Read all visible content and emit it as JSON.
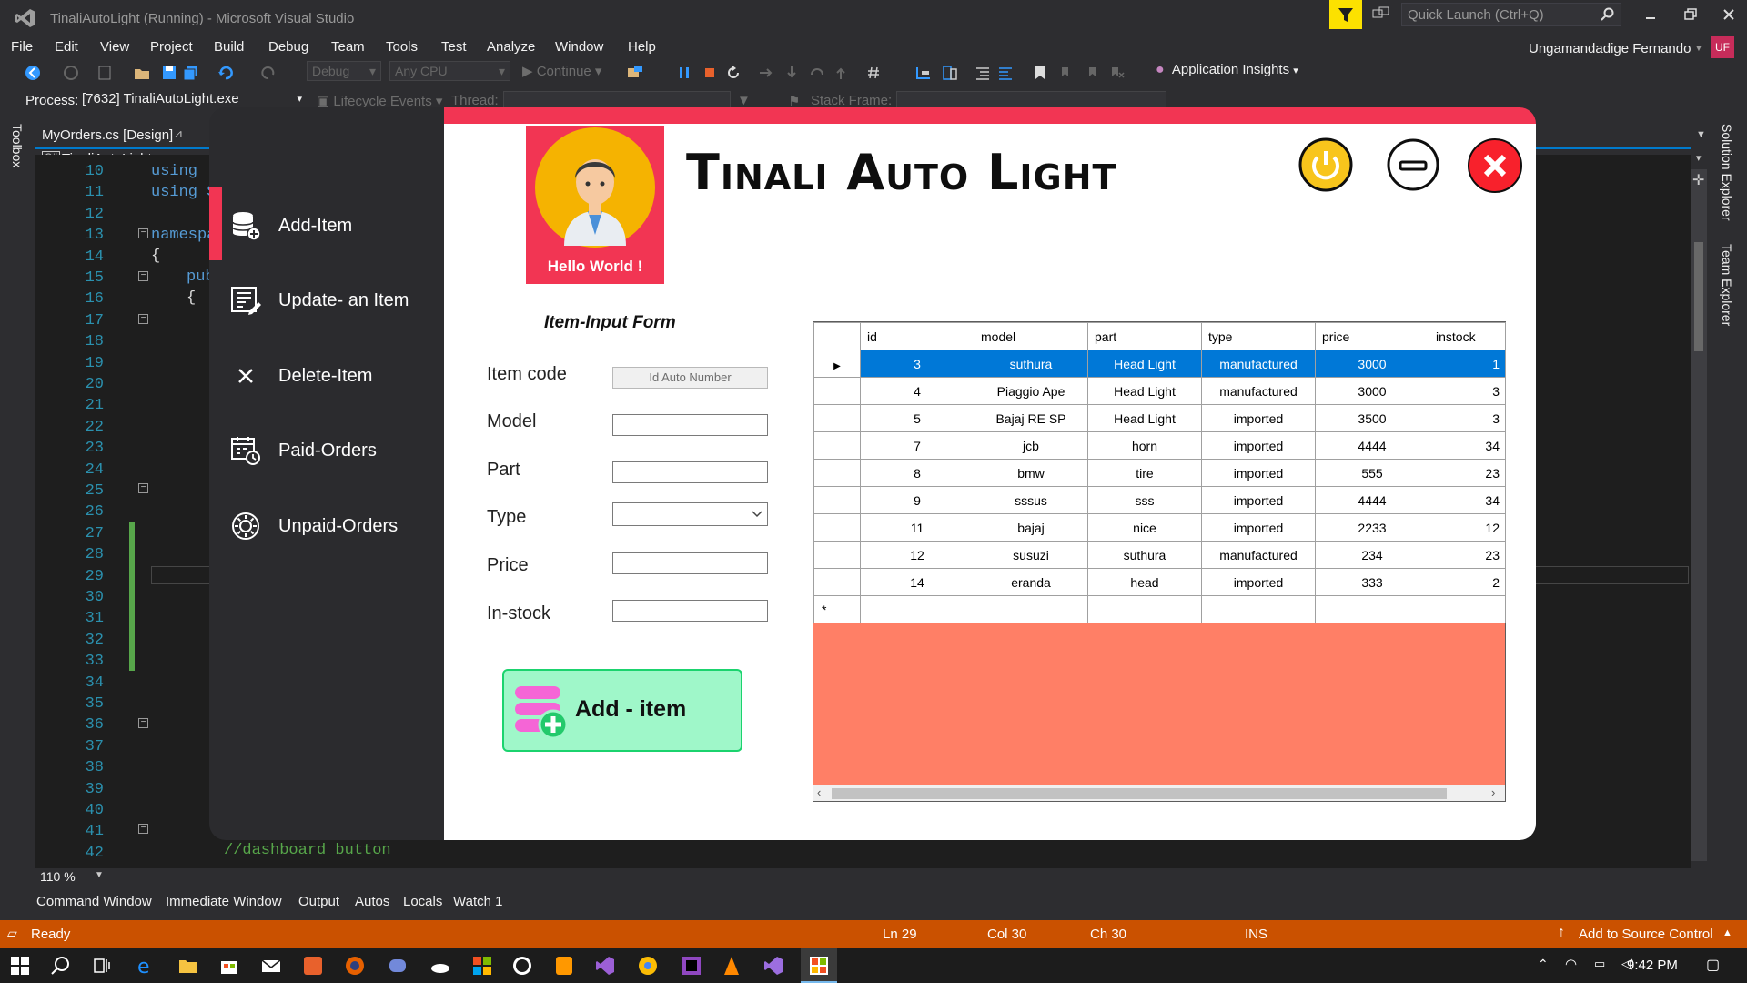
{
  "vs": {
    "title": "TinaliAutoLight (Running) - Microsoft Visual Studio",
    "quick_launch_placeholder": "Quick Launch (Ctrl+Q)",
    "user_name": "Ungamandadige Fernando",
    "user_initials": "UF",
    "menu": [
      "File",
      "Edit",
      "View",
      "Project",
      "Build",
      "Debug",
      "Team",
      "Tools",
      "Test",
      "Analyze",
      "Window",
      "Help"
    ],
    "toolbar": {
      "config": "Debug",
      "platform": "Any CPU",
      "continue_label": "Continue",
      "app_insights": "Application Insights"
    },
    "debugbar": {
      "process_label": "Process:",
      "process_value": "[7632] TinaliAutoLight.exe",
      "lifecycle_label": "Lifecycle Events",
      "thread_label": "Thread:",
      "stack_label": "Stack Frame:"
    },
    "toolbox_label": "Toolbox",
    "doc_tab": "MyOrders.cs [Design]",
    "breadcrumb": "TinaliAutoLight",
    "right_strip": [
      "Solution Explorer",
      "Team Explorer"
    ],
    "line_numbers": [
      "10",
      "11",
      "12",
      "13",
      "14",
      "15",
      "16",
      "17",
      "18",
      "19",
      "20",
      "21",
      "22",
      "23",
      "24",
      "25",
      "26",
      "27",
      "28",
      "29",
      "30",
      "31",
      "32",
      "33",
      "34",
      "35",
      "36",
      "37",
      "38",
      "39",
      "40",
      "41",
      "42"
    ],
    "code": {
      "l10": "using",
      "l11": "using S",
      "l13": "namespa",
      "l14": "{",
      "l15": "pub",
      "l16": "{",
      "comment": "//dashboard button"
    },
    "zoom": "110 %",
    "bottom_tabs": [
      "Command Window",
      "Immediate Window",
      "Output",
      "Autos",
      "Locals",
      "Watch 1"
    ],
    "status": {
      "ready": "Ready",
      "ln": "Ln 29",
      "col": "Col 30",
      "ch": "Ch 30",
      "ins": "INS",
      "source_control": "Add to Source Control"
    },
    "clock": "9:42 PM"
  },
  "app": {
    "brand_title": "Tinali Auto Light",
    "avatar_caption": "Hello World !",
    "nav": [
      {
        "label": "Add-Item",
        "icon": "database-add-icon"
      },
      {
        "label": "Update- an Item",
        "icon": "edit-list-icon"
      },
      {
        "label": "Delete-Item",
        "icon": "close-icon"
      },
      {
        "label": "Paid-Orders",
        "icon": "calendar-clock-icon"
      },
      {
        "label": "Unpaid-Orders",
        "icon": "circle-gear-icon"
      }
    ],
    "form": {
      "title": "Item-Input Form",
      "item_code_label": "Item code",
      "item_code_value": "Id Auto Number",
      "model_label": "Model",
      "part_label": "Part",
      "type_label": "Type",
      "price_label": "Price",
      "instock_label": "In-stock",
      "add_button": "Add - item"
    },
    "grid": {
      "columns": [
        "id",
        "model",
        "part",
        "type",
        "price",
        "instock"
      ],
      "rows": [
        [
          "3",
          "suthura",
          "Head Light",
          "manufactured",
          "3000",
          "1"
        ],
        [
          "4",
          "Piaggio Ape",
          "Head Light",
          "manufactured",
          "3000",
          "3"
        ],
        [
          "5",
          "Bajaj RE SP",
          "Head Light",
          "imported",
          "3500",
          "3"
        ],
        [
          "7",
          "jcb",
          "horn",
          "imported",
          "4444",
          "34"
        ],
        [
          "8",
          "bmw",
          "tire",
          "imported",
          "555",
          "23"
        ],
        [
          "9",
          "sssus",
          "sss",
          "imported",
          "4444",
          "34"
        ],
        [
          "11",
          "bajaj",
          "nice",
          "imported",
          "2233",
          "12"
        ],
        [
          "12",
          "susuzi",
          "suthura",
          "manufactured",
          "234",
          "23"
        ],
        [
          "14",
          "eranda",
          "head",
          "imported",
          "333",
          "2"
        ]
      ],
      "new_row_marker": "*"
    }
  }
}
